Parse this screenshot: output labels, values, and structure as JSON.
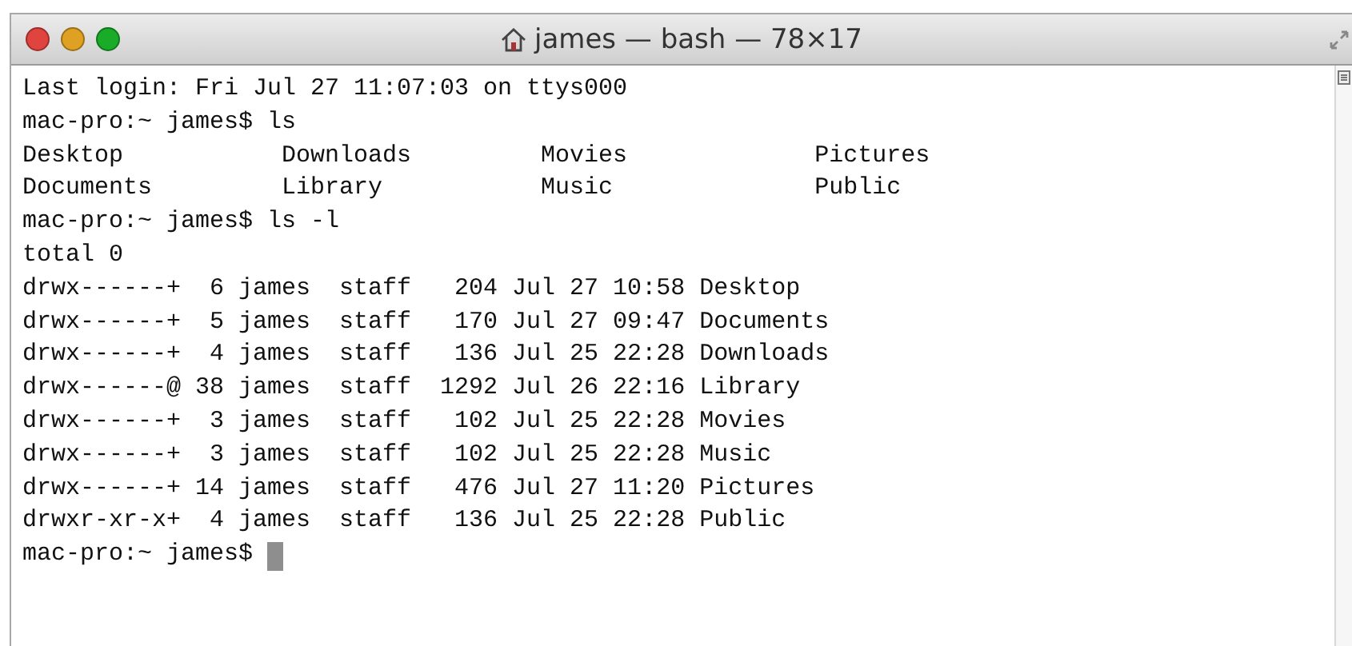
{
  "window": {
    "title": "james — bash — 78×17"
  },
  "terminal": {
    "lines": [
      "Last login: Fri Jul 27 11:07:03 on ttys000",
      "mac-pro:~ james$ ls",
      "Desktop           Downloads         Movies             Pictures",
      "Documents         Library           Music              Public",
      "mac-pro:~ james$ ls -l",
      "total 0",
      "drwx------+  6 james  staff   204 Jul 27 10:58 Desktop",
      "drwx------+  5 james  staff   170 Jul 27 09:47 Documents",
      "drwx------+  4 james  staff   136 Jul 25 22:28 Downloads",
      "drwx------@ 38 james  staff  1292 Jul 26 22:16 Library",
      "drwx------+  3 james  staff   102 Jul 25 22:28 Movies",
      "drwx------+  3 james  staff   102 Jul 25 22:28 Music",
      "drwx------+ 14 james  staff   476 Jul 27 11:20 Pictures",
      "drwxr-xr-x+  4 james  staff   136 Jul 25 22:28 Public"
    ],
    "prompt": "mac-pro:~ james$"
  }
}
